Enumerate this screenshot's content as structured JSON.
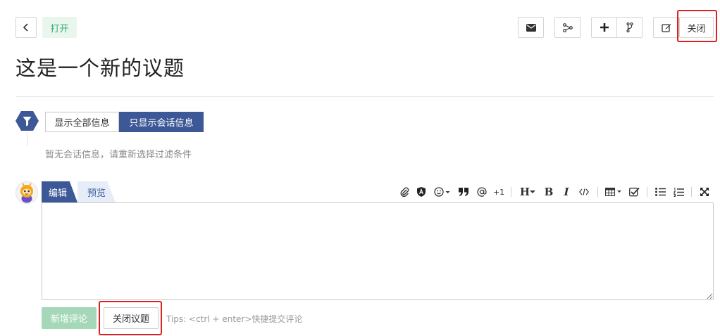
{
  "header": {
    "status_badge": "打开",
    "close_button": "关闭"
  },
  "issue": {
    "title": "这是一个新的议题"
  },
  "filter": {
    "options": [
      "显示全部信息",
      "只显示会话信息"
    ],
    "active_index": 1,
    "empty_message": "暂无会话信息，请重新选择过滤条件"
  },
  "editor": {
    "tabs": [
      "编辑",
      "预览"
    ],
    "active_tab": 0,
    "toolbar": {
      "plus_one": "+1",
      "heading": "H",
      "bold": "B",
      "italic": "I"
    },
    "value": ""
  },
  "actions": {
    "add_comment": "新增评论",
    "close_issue": "关闭议题",
    "tips": "Tips: <ctrl + enter>快捷提交评论"
  },
  "colors": {
    "accent": "#3d5896",
    "open_green": "#3bb06b",
    "highlight": "#e02020",
    "disabled_green": "#a5d8b9"
  }
}
